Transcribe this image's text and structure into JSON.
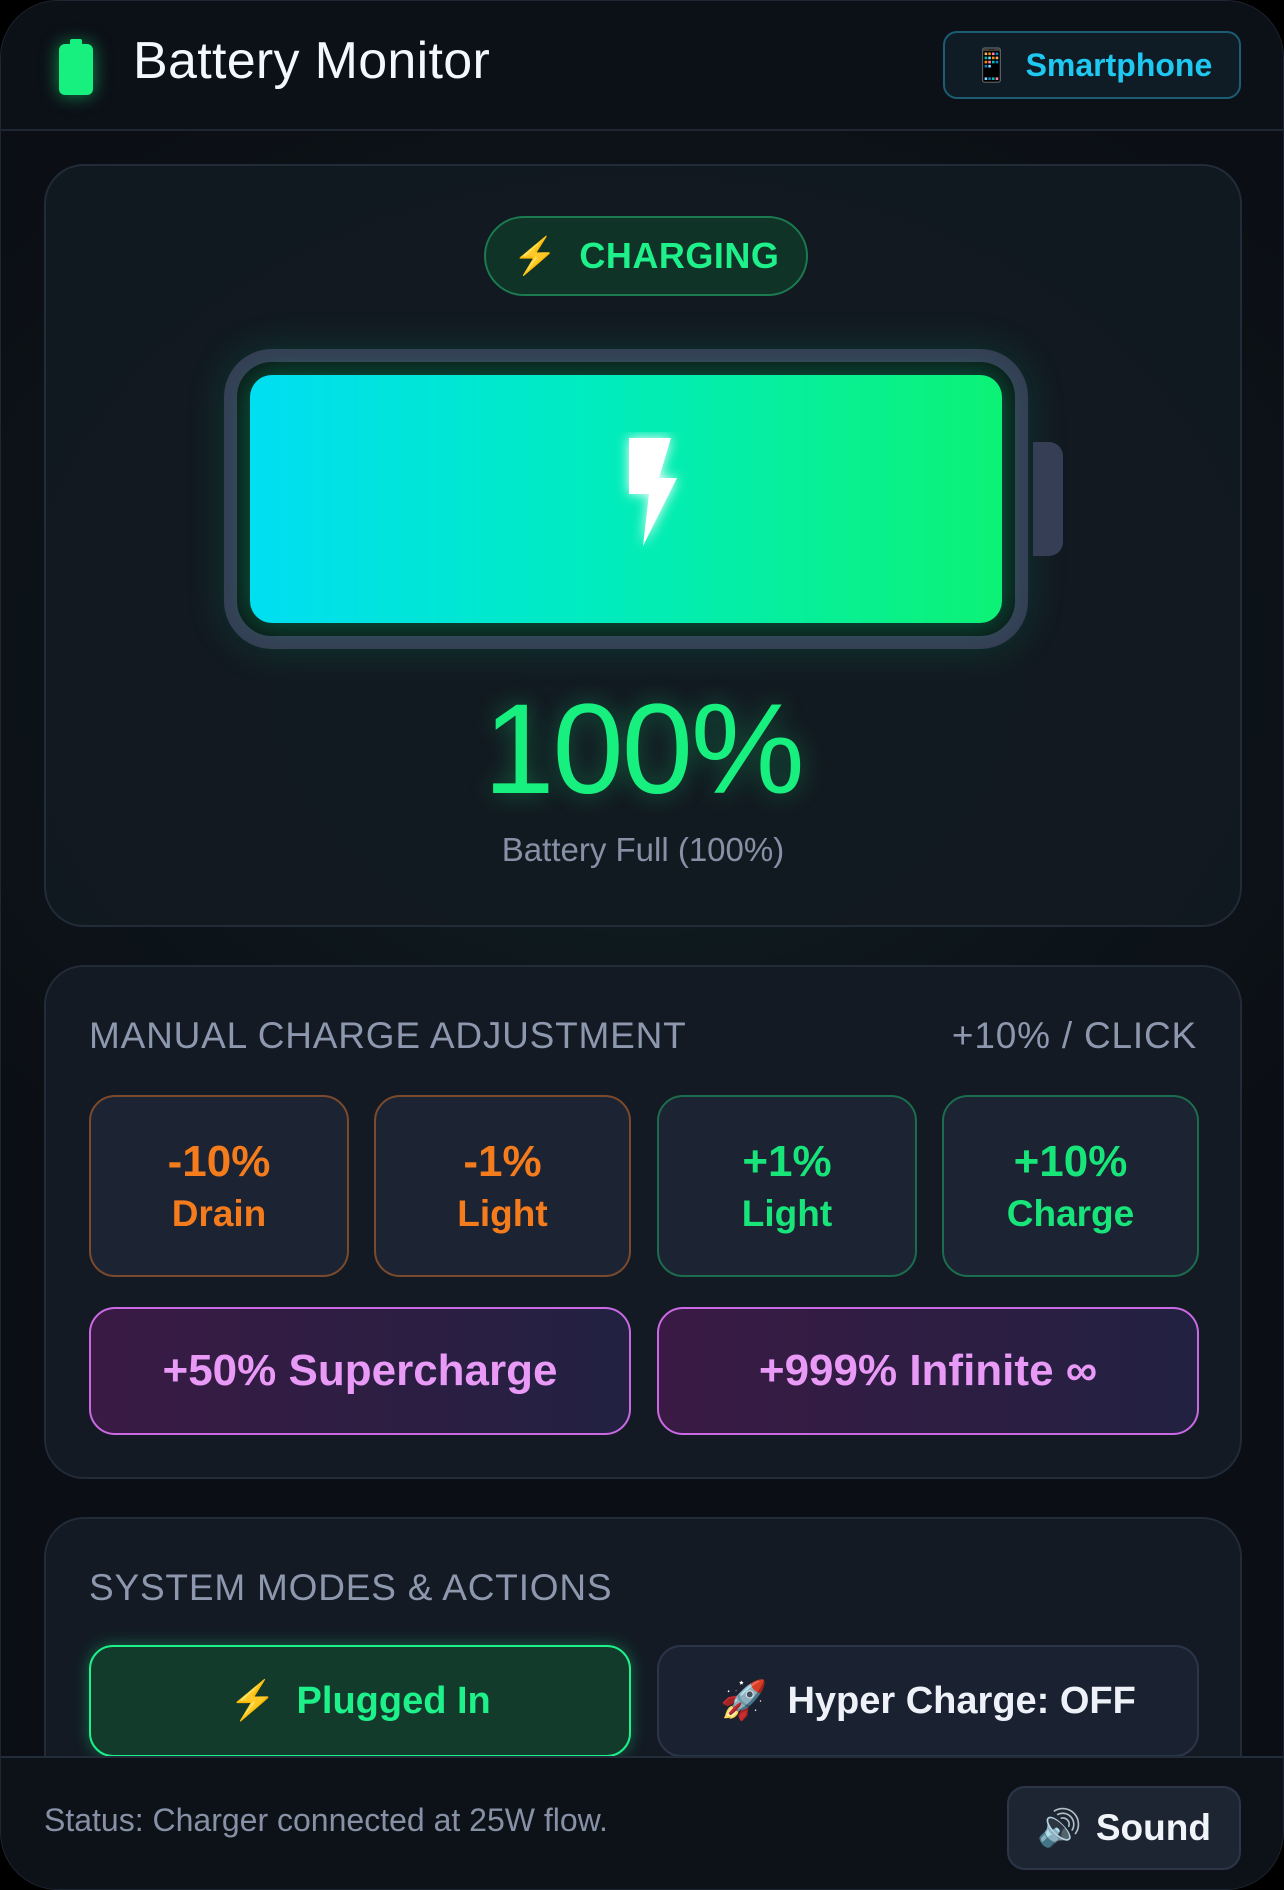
{
  "header": {
    "title": "Battery Monitor",
    "logo_icon": "battery-icon",
    "device": {
      "icon": "smartphone-icon",
      "icon_glyph": "📱",
      "label": "Smartphone"
    }
  },
  "battery": {
    "status_icon_glyph": "⚡",
    "status": "CHARGING",
    "level_fraction": 1.0,
    "percent_label": "100%",
    "subtitle": "Battery Full (100%)"
  },
  "manual": {
    "title": "MANUAL CHARGE ADJUSTMENT",
    "meta": "+10% / CLICK",
    "buttons": [
      {
        "value": "-10%",
        "label": "Drain"
      },
      {
        "value": "-1%",
        "label": "Light"
      },
      {
        "value": "+1%",
        "label": "Light"
      },
      {
        "value": "+10%",
        "label": "Charge"
      }
    ],
    "supercharge": "+50% Supercharge",
    "infinite": "+999% Infinite ∞"
  },
  "system": {
    "title": "SYSTEM MODES & ACTIONS",
    "plugged": {
      "icon_glyph": "⚡",
      "label": "Plugged In"
    },
    "hyper": {
      "icon_glyph": "🚀",
      "label": "Hyper Charge: OFF"
    }
  },
  "footer": {
    "status": "Status: Charger connected at 25W flow.",
    "sound": {
      "icon_glyph": "🔊",
      "label": "Sound"
    }
  },
  "colors": {
    "accent_green": "#17f07e",
    "accent_cyan": "#1ec8f0",
    "drain_orange": "#f57c1c",
    "super_purple": "#e99af7"
  }
}
